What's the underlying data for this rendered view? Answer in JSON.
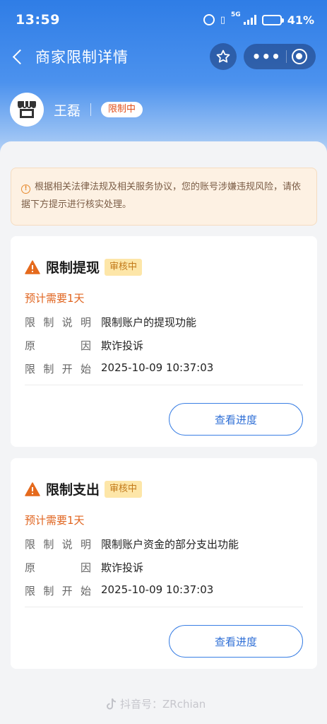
{
  "status_bar": {
    "time": "13:59",
    "network": "5G",
    "battery": "41%"
  },
  "nav": {
    "title": "商家限制详情"
  },
  "merchant": {
    "name": "王磊",
    "status": "限制中"
  },
  "notice": {
    "text": "根据相关法律法规及相关服务协议，您的账号涉嫌违规风险，请依据下方提示进行核实处理。"
  },
  "labels": {
    "desc": [
      "限",
      "制",
      "说",
      "明"
    ],
    "reason": [
      "原",
      "因"
    ],
    "start": [
      "限",
      "制",
      "开",
      "始"
    ]
  },
  "cards": [
    {
      "title": "限制提现",
      "badge": "审核中",
      "eta": "预计需要1天",
      "description": "限制账户的提现功能",
      "reason": "欺诈投诉",
      "start_time": "2025-10-09 10:37:03",
      "button": "查看进度"
    },
    {
      "title": "限制支出",
      "badge": "审核中",
      "eta": "预计需要1天",
      "description": "限制账户资金的部分支出功能",
      "reason": "欺诈投诉",
      "start_time": "2025-10-09 10:37:03",
      "button": "查看进度"
    }
  ],
  "watermark": "抖音号：ZRchian"
}
